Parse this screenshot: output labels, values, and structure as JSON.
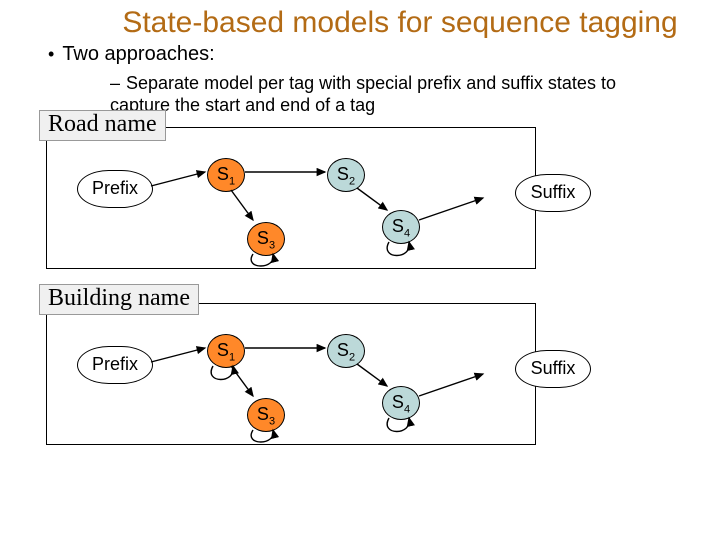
{
  "title": "State-based models for sequence tagging",
  "bullet": "Two approaches:",
  "sub_bullet": "Separate model per tag with special prefix and suffix states to capture the start and end of a tag",
  "panels": [
    {
      "label": "Road name",
      "prefix": "Prefix",
      "suffix": "Suffix",
      "s1": "S",
      "s1n": "1",
      "s2": "S",
      "s2n": "2",
      "s3": "S",
      "s3n": "3",
      "s4": "S",
      "s4n": "4"
    },
    {
      "label": "Building name",
      "prefix": "Prefix",
      "suffix": "Suffix",
      "s1": "S",
      "s1n": "1",
      "s2": "S",
      "s2n": "2",
      "s3": "S",
      "s3n": "3",
      "s4": "S",
      "s4n": "4"
    }
  ]
}
